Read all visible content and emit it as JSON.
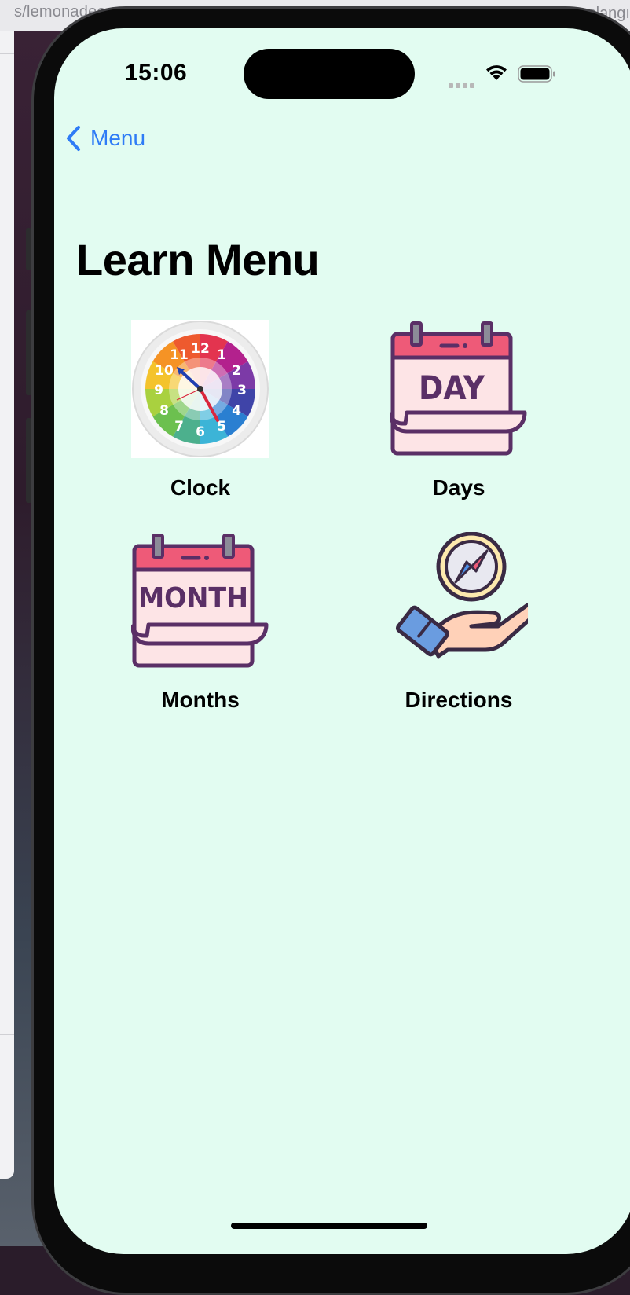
{
  "browser": {
    "url_fragment": "s/lemonadee",
    "right_text": "Başlangı"
  },
  "status_bar": {
    "time": "15:06"
  },
  "nav": {
    "back_label": "Menu"
  },
  "page": {
    "title": "Learn Menu"
  },
  "tiles": [
    {
      "label": "Clock",
      "icon": "clock-icon"
    },
    {
      "label": "Days",
      "icon": "day-calendar-icon",
      "icon_text": "DAY"
    },
    {
      "label": "Months",
      "icon": "month-calendar-icon",
      "icon_text": "MONTH"
    },
    {
      "label": "Directions",
      "icon": "compass-hand-icon"
    }
  ],
  "clock_numbers": [
    "12",
    "1",
    "2",
    "3",
    "4",
    "5",
    "6",
    "7",
    "8",
    "9",
    "10",
    "11"
  ],
  "colors": {
    "background": "#e2fcf1",
    "accent": "#2f7cf6",
    "calendar_outline": "#5a2f66",
    "calendar_header": "#ee5a78",
    "calendar_body": "#fde4e6"
  }
}
